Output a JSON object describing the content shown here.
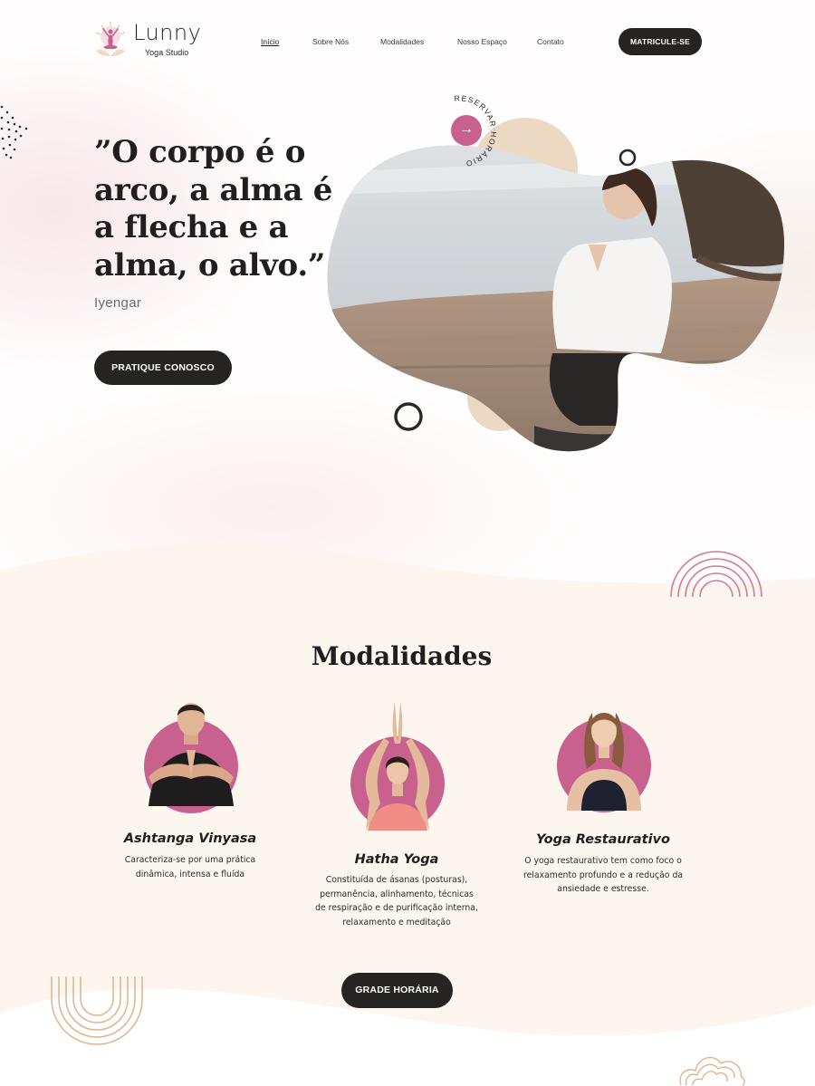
{
  "header": {
    "brand": "Lunny",
    "brand_sub": "Yoga Studio",
    "nav": [
      {
        "label": "Início"
      },
      {
        "label": "Sobre Nós"
      },
      {
        "label": "Modalidades"
      },
      {
        "label": "Nosso Espaço"
      },
      {
        "label": "Contato"
      }
    ],
    "cta_label": "MATRICULE-SE"
  },
  "hero": {
    "quote_lines": [
      "”O corpo é o",
      "arco, a alma é",
      "a flecha e a",
      "alma, o alvo.”"
    ],
    "author": "Iyengar",
    "cta_label": "PRATIQUE CONOSCO",
    "reserve_text": "RESERVAR HORÁRIO",
    "reserve_arrow": "→"
  },
  "modalidades": {
    "title": "Modalidades",
    "cards": [
      {
        "name": "Ashtanga Vinyasa",
        "desc_lines": [
          "Caracteriza-se por uma prática",
          "dinâmica, intensa e fluída"
        ]
      },
      {
        "name": "Hatha Yoga",
        "desc_lines": [
          "Constituída de ásanas (posturas),",
          "permanência, alinhamento, técnicas",
          "de respiração e de purificação interna,",
          "relaxamento e meditação"
        ]
      },
      {
        "name": "Yoga Restaurativo",
        "desc_lines": [
          "O yoga restaurativo tem como foco o",
          "relaxamento profundo e a redução da",
          "ansiedade e estresse."
        ]
      }
    ],
    "cta_label": "GRADE HORÁRIA"
  },
  "colors": {
    "accent_pink": "#c9618f",
    "dark": "#262322",
    "beige": "#ecd9c3",
    "cream": "#fdf6ef"
  }
}
